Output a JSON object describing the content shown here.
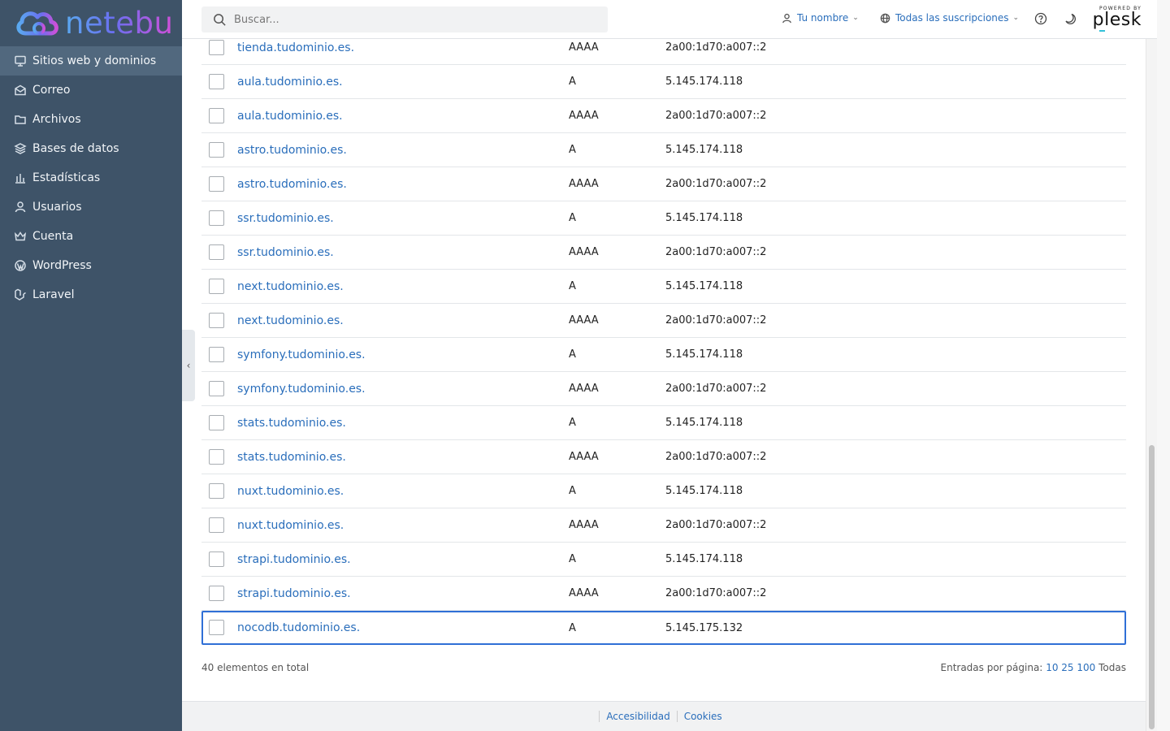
{
  "brand": {
    "name": "netebu"
  },
  "search": {
    "placeholder": "Buscar..."
  },
  "header": {
    "user_label": "Tu nombre",
    "subscriptions_label": "Todas las suscripciones",
    "plesk_powered": "POWERED BY",
    "plesk_word": "plesk"
  },
  "sidebar": {
    "items": [
      {
        "label": "Sitios web y dominios",
        "icon": "monitor-icon"
      },
      {
        "label": "Correo",
        "icon": "mail-icon"
      },
      {
        "label": "Archivos",
        "icon": "folder-icon"
      },
      {
        "label": "Bases de datos",
        "icon": "database-icon"
      },
      {
        "label": "Estadísticas",
        "icon": "chart-icon"
      },
      {
        "label": "Usuarios",
        "icon": "user-icon"
      },
      {
        "label": "Cuenta",
        "icon": "crown-icon"
      },
      {
        "label": "WordPress",
        "icon": "wordpress-icon"
      },
      {
        "label": "Laravel",
        "icon": "laravel-icon"
      }
    ]
  },
  "records": [
    {
      "host": "tienda.tudominio.es.",
      "type": "AAAA",
      "value": "2a00:1d70:a007::2"
    },
    {
      "host": "aula.tudominio.es.",
      "type": "A",
      "value": "5.145.174.118"
    },
    {
      "host": "aula.tudominio.es.",
      "type": "AAAA",
      "value": "2a00:1d70:a007::2"
    },
    {
      "host": "astro.tudominio.es.",
      "type": "A",
      "value": "5.145.174.118"
    },
    {
      "host": "astro.tudominio.es.",
      "type": "AAAA",
      "value": "2a00:1d70:a007::2"
    },
    {
      "host": "ssr.tudominio.es.",
      "type": "A",
      "value": "5.145.174.118"
    },
    {
      "host": "ssr.tudominio.es.",
      "type": "AAAA",
      "value": "2a00:1d70:a007::2"
    },
    {
      "host": "next.tudominio.es.",
      "type": "A",
      "value": "5.145.174.118"
    },
    {
      "host": "next.tudominio.es.",
      "type": "AAAA",
      "value": "2a00:1d70:a007::2"
    },
    {
      "host": "symfony.tudominio.es.",
      "type": "A",
      "value": "5.145.174.118"
    },
    {
      "host": "symfony.tudominio.es.",
      "type": "AAAA",
      "value": "2a00:1d70:a007::2"
    },
    {
      "host": "stats.tudominio.es.",
      "type": "A",
      "value": "5.145.174.118"
    },
    {
      "host": "stats.tudominio.es.",
      "type": "AAAA",
      "value": "2a00:1d70:a007::2"
    },
    {
      "host": "nuxt.tudominio.es.",
      "type": "A",
      "value": "5.145.174.118"
    },
    {
      "host": "nuxt.tudominio.es.",
      "type": "AAAA",
      "value": "2a00:1d70:a007::2"
    },
    {
      "host": "strapi.tudominio.es.",
      "type": "A",
      "value": "5.145.174.118"
    },
    {
      "host": "strapi.tudominio.es.",
      "type": "AAAA",
      "value": "2a00:1d70:a007::2"
    },
    {
      "host": "nocodb.tudominio.es.",
      "type": "A",
      "value": "5.145.175.132",
      "selected": true
    }
  ],
  "pagination": {
    "total": "40 elementos en total",
    "label": "Entradas por página:",
    "options": [
      "10",
      "25",
      "100"
    ],
    "current": "Todas"
  },
  "footer": {
    "links": [
      "Accesibilidad",
      "Cookies"
    ]
  },
  "colors": {
    "sidebar": "#3e5368",
    "sidebar_active": "#51687e",
    "link": "#2a6ebb",
    "selection": "#2f6fd6"
  }
}
